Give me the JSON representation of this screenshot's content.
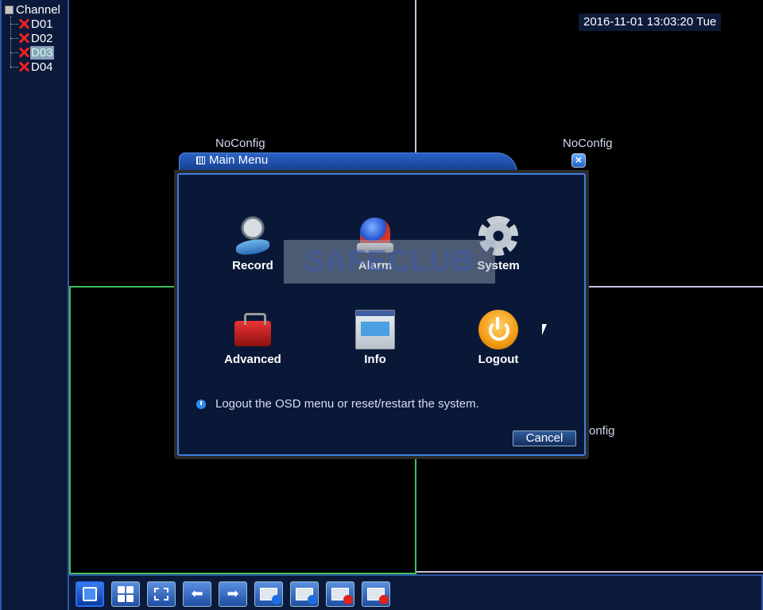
{
  "sidebar": {
    "root_label": "Channel",
    "channels": [
      {
        "label": "D01",
        "selected": false
      },
      {
        "label": "D02",
        "selected": false
      },
      {
        "label": "D03",
        "selected": true
      },
      {
        "label": "D04",
        "selected": false
      }
    ]
  },
  "video": {
    "datetime": "2016-11-01 13:03:20 Tue",
    "status_labels": [
      "NoConfig",
      "NoConfig",
      "onfig"
    ]
  },
  "dialog": {
    "title": "Main Menu",
    "close_glyph": "×",
    "items": [
      {
        "label": "Record",
        "icon": "record-icon"
      },
      {
        "label": "Alarm",
        "icon": "alarm-icon"
      },
      {
        "label": "System",
        "icon": "system-icon"
      },
      {
        "label": "Advanced",
        "icon": "advanced-icon"
      },
      {
        "label": "Info",
        "icon": "info-icon"
      },
      {
        "label": "Logout",
        "icon": "logout-icon"
      }
    ],
    "hint": "Logout the OSD menu or reset/restart the system.",
    "cancel_label": "Cancel"
  },
  "watermark": "SAFECLUB",
  "toolbar": {
    "buttons": [
      {
        "name": "single-view-button"
      },
      {
        "name": "quad-view-button"
      },
      {
        "name": "fullscreen-button"
      },
      {
        "name": "previous-button"
      },
      {
        "name": "next-button"
      },
      {
        "name": "start-tour-button"
      },
      {
        "name": "stop-tour-button"
      },
      {
        "name": "record-button"
      },
      {
        "name": "stop-record-button"
      }
    ]
  },
  "colors": {
    "panel_bg": "#0b1a3a",
    "panel_border": "#2e58a8",
    "error_x": "#ee2222",
    "grid_violet": "#c9c0e2",
    "grid_green": "#3fbf55"
  }
}
